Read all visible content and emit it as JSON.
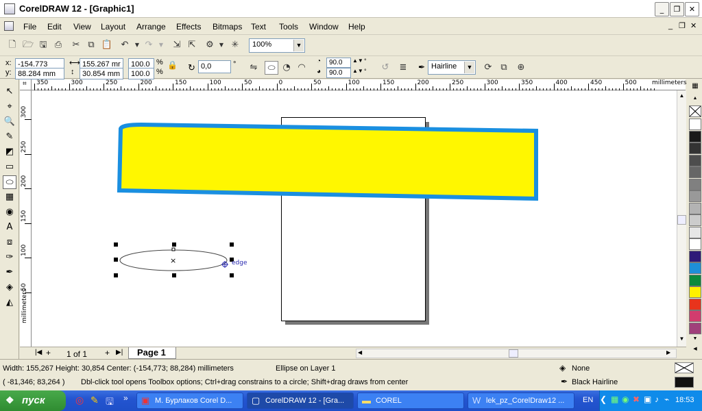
{
  "window": {
    "title": "CorelDRAW 12 - [Graphic1]"
  },
  "menu": [
    "File",
    "Edit",
    "View",
    "Layout",
    "Arrange",
    "Effects",
    "Bitmaps",
    "Text",
    "Tools",
    "Window",
    "Help"
  ],
  "standard_toolbar": {
    "zoom": "100%"
  },
  "property_bar": {
    "x_label": "x:",
    "x": "-154.773 mm",
    "y_label": "y:",
    "y": "88.284 mm",
    "width": "155.267 mr",
    "height": "30.854 mm",
    "scale_x": "100.0",
    "scale_y": "100.0",
    "percent": "%",
    "rotation": "0,0",
    "degree": "°",
    "start_angle": "90.0",
    "end_angle": "90.0",
    "outline": "Hairline"
  },
  "ruler_top": {
    "unit": "millimeters",
    "ticks": [
      "350",
      "300",
      "250",
      "200",
      "150",
      "100",
      "50",
      "0",
      "50",
      "100",
      "150",
      "200",
      "250",
      "300",
      "350",
      "400",
      "450",
      "500"
    ]
  },
  "ruler_left": {
    "unit": "millimeters",
    "ticks": [
      "300",
      "250",
      "200",
      "150",
      "100",
      "50"
    ]
  },
  "canvas": {
    "snap_label": "edge"
  },
  "page_nav": {
    "counter": "1 of 1",
    "tab": "Page 1"
  },
  "status": {
    "line1": "Width: 155,267  Height: 30,854  Center: (-154,773; 88,284)  millimeters",
    "object": "Ellipse on Layer 1",
    "line2": "( -81,346; 83,264 )",
    "hint": "Dbl-click tool opens Toolbox options; Ctrl+drag constrains to a circle; Shift+drag draws from center",
    "fill": "None",
    "outline": "Black  Hairline"
  },
  "palette": [
    "#ffffff",
    "#1a1a1a",
    "#333333",
    "#4d4d4d",
    "#666666",
    "#808080",
    "#999999",
    "#b3b3b3",
    "#cccccc",
    "#e6e6e6",
    "#ffffff",
    "#2e1a78",
    "#1e8fd8",
    "#0c8a3c",
    "#fff200",
    "#e8341c",
    "#d23c6e",
    "#a0407a"
  ],
  "taskbar": {
    "start": "пуск",
    "tasks": [
      "М. Бурлаков Corel D...",
      "CorelDRAW 12 - [Gra...",
      "COREL",
      "lek_pz_CorelDraw12 ..."
    ],
    "lang": "EN",
    "clock": "18:53"
  },
  "colors": {
    "banner_fill": "#fff700",
    "banner_stroke": "#1a8fe0"
  }
}
